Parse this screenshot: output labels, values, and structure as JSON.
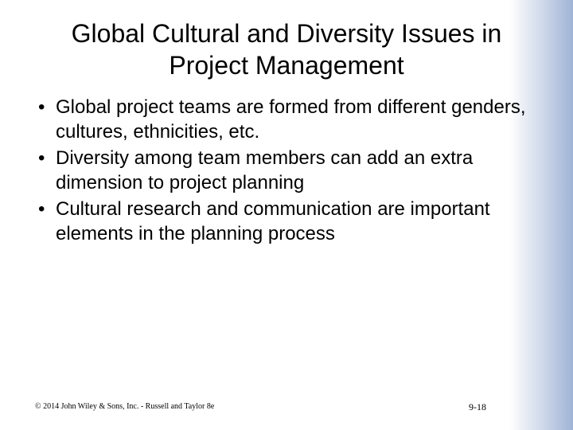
{
  "slide": {
    "title_line1": "Global Cultural and Diversity Issues in",
    "title_line2": "Project Management",
    "bullet_glyph": "•",
    "bullets": [
      "Global project teams are formed from different genders, cultures, ethnicities, etc.",
      "Diversity among team members can add an extra dimension to project planning",
      "Cultural research and communication are important elements in the planning process"
    ],
    "footer_copyright": "© 2014 John Wiley & Sons, Inc. - Russell and Taylor 8e",
    "footer_page": "9-18"
  },
  "colors": {
    "background": "#ffffff",
    "side_gradient": "#9fb4d6",
    "text": "#000000"
  }
}
